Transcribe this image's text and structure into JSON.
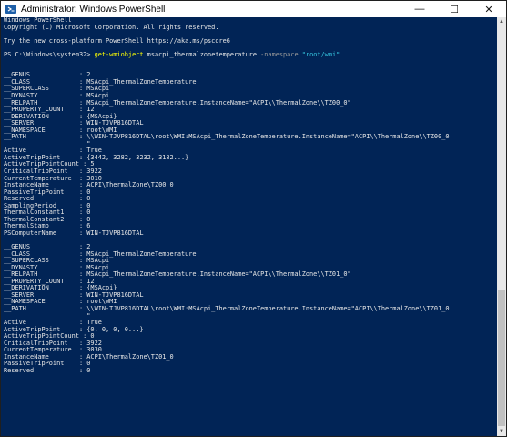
{
  "window": {
    "title": "Administrator: Windows PowerShell",
    "icon": "powershell-icon",
    "controls": {
      "minimize": "—",
      "maximize": "☐",
      "close": "✕"
    }
  },
  "console": {
    "banner": [
      "Windows PowerShell",
      "Copyright (C) Microsoft Corporation. All rights reserved.",
      "",
      "Try the new cross-platform PowerShell https://aka.ms/pscore6",
      ""
    ],
    "command": {
      "prompt": "PS C:\\Windows\\system32> ",
      "cmdlet": "get-wmiobject",
      "arg": " msacpi_thermalzonetemperature ",
      "param": "-namespace",
      "value": " \"root/wmi\""
    },
    "output": [
      "",
      "",
      "__GENUS             : 2",
      "__CLASS             : MSAcpi_ThermalZoneTemperature",
      "__SUPERCLASS        : MSAcpi",
      "__DYNASTY           : MSAcpi",
      "__RELPATH           : MSAcpi_ThermalZoneTemperature.InstanceName=\"ACPI\\\\ThermalZone\\\\TZ00_0\"",
      "__PROPERTY_COUNT    : 12",
      "__DERIVATION        : {MSAcpi}",
      "__SERVER            : WIN-TJVP816DTAL",
      "__NAMESPACE         : root\\WMI",
      "__PATH              : \\\\WIN-TJVP816DTAL\\root\\WMI:MSAcpi_ThermalZoneTemperature.InstanceName=\"ACPI\\\\ThermalZone\\\\TZ00_0",
      "                      \"",
      "Active              : True",
      "ActiveTripPoint     : {3442, 3282, 3232, 3182...}",
      "ActiveTripPointCount : 5",
      "CriticalTripPoint   : 3922",
      "CurrentTemperature  : 3010",
      "InstanceName        : ACPI\\ThermalZone\\TZ00_0",
      "PassiveTripPoint    : 0",
      "Reserved            : 0",
      "SamplingPeriod      : 0",
      "ThermalConstant1    : 0",
      "ThermalConstant2    : 0",
      "ThermalStamp        : 6",
      "PSComputerName      : WIN-TJVP816DTAL",
      "",
      "__GENUS             : 2",
      "__CLASS             : MSAcpi_ThermalZoneTemperature",
      "__SUPERCLASS        : MSAcpi",
      "__DYNASTY           : MSAcpi",
      "__RELPATH           : MSAcpi_ThermalZoneTemperature.InstanceName=\"ACPI\\\\ThermalZone\\\\TZ01_0\"",
      "__PROPERTY_COUNT    : 12",
      "__DERIVATION        : {MSAcpi}",
      "__SERVER            : WIN-TJVP816DTAL",
      "__NAMESPACE         : root\\WMI",
      "__PATH              : \\\\WIN-TJVP816DTAL\\root\\WMI:MSAcpi_ThermalZoneTemperature.InstanceName=\"ACPI\\\\ThermalZone\\\\TZ01_0",
      "                      \"",
      "Active              : True",
      "ActiveTripPoint     : {0, 0, 0, 0...}",
      "ActiveTripPointCount : 0",
      "CriticalTripPoint   : 3922",
      "CurrentTemperature  : 3030",
      "InstanceName        : ACPI\\ThermalZone\\TZ01_0",
      "PassiveTripPoint    : 0",
      "Reserved            : 0"
    ]
  },
  "colors": {
    "console_bg": "#012456",
    "console_text": "#e6e6e6",
    "cmdlet": "#ffff00",
    "parameter": "#9a9a9a",
    "string": "#35c6e0"
  }
}
